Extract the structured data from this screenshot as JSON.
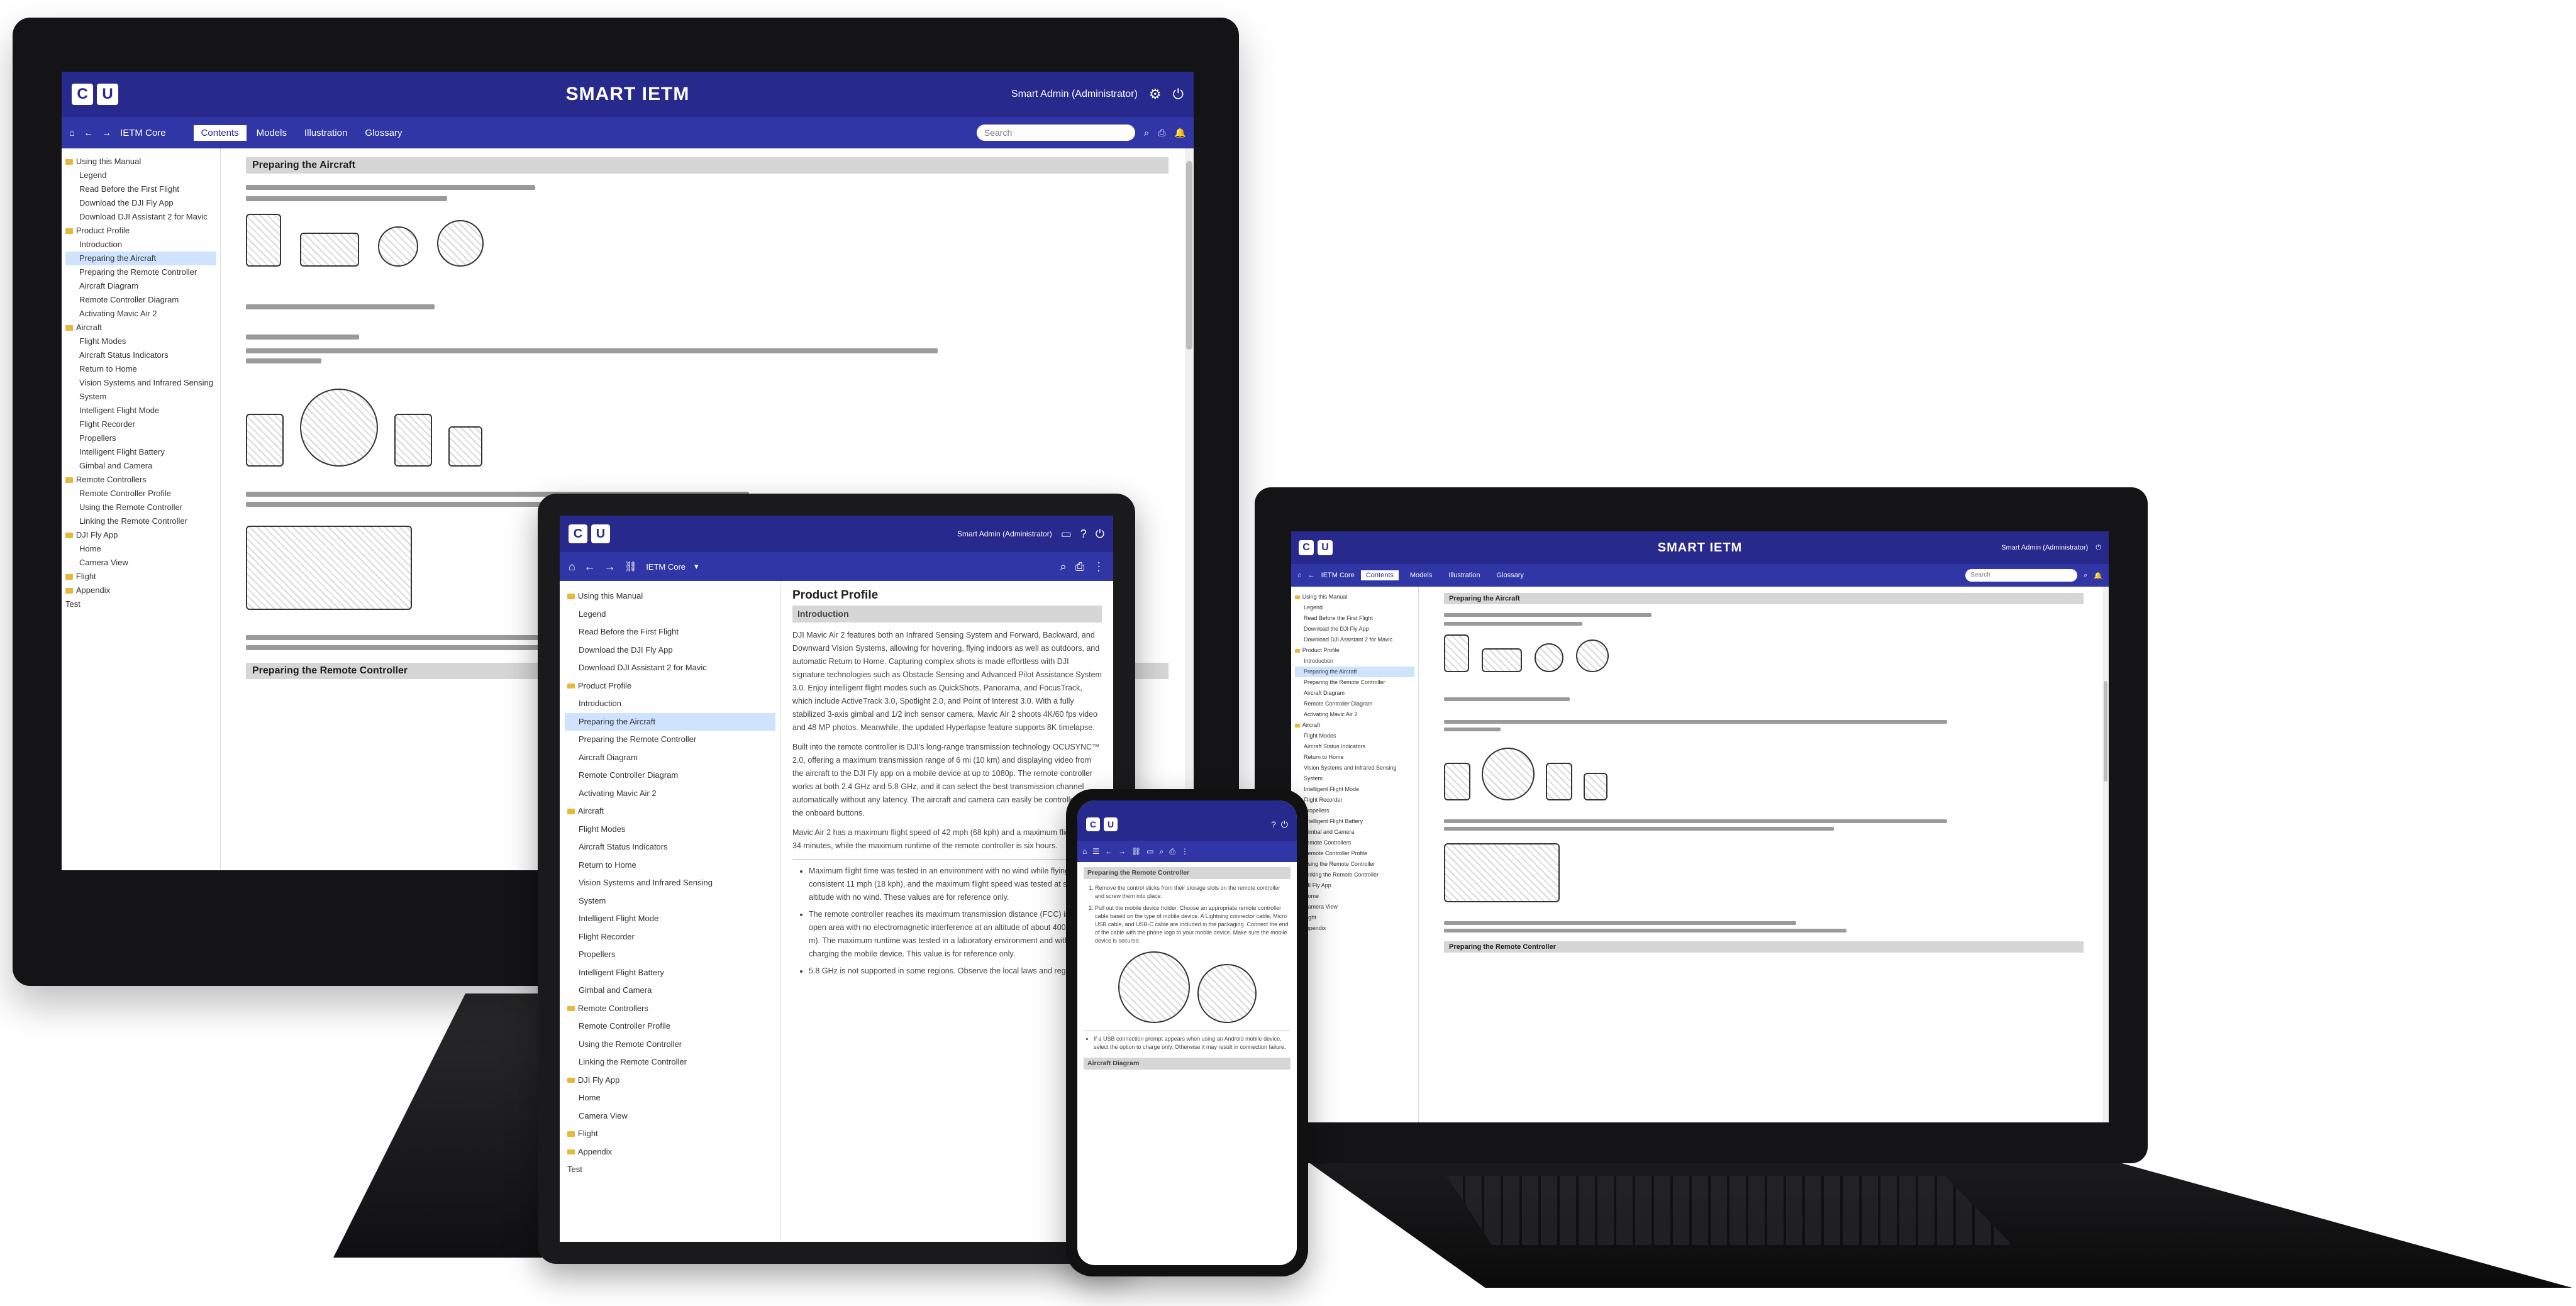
{
  "app": {
    "brand": "SMART IETM",
    "logo": [
      "C",
      "U"
    ],
    "user": "Smart Admin (Administrator)",
    "search_placeholder": "Search",
    "nav_tabs": [
      "Contents",
      "Models",
      "Illustration",
      "Glossary"
    ],
    "ietm_selector": "IETM Core"
  },
  "colors": {
    "topbar": "#27298c",
    "navbar": "#3136a6",
    "folder": "#e7b93a",
    "highlight": "#cfe3ff",
    "section_head": "#d6d6d6"
  },
  "tablet": {
    "sidebar": [
      {
        "label": "Using this Manual",
        "level": 0,
        "folder": true
      },
      {
        "label": "Legend",
        "level": 1
      },
      {
        "label": "Read Before the First Flight",
        "level": 1
      },
      {
        "label": "Download the DJI Fly App",
        "level": 1
      },
      {
        "label": "Download DJI Assistant 2 for Mavic",
        "level": 1
      },
      {
        "label": "Product Profile",
        "level": 0,
        "folder": true
      },
      {
        "label": "Introduction",
        "level": 1
      },
      {
        "label": "Preparing the Aircraft",
        "level": 1,
        "selected": true
      },
      {
        "label": "Preparing the Remote Controller",
        "level": 1
      },
      {
        "label": "Aircraft Diagram",
        "level": 1
      },
      {
        "label": "Remote Controller Diagram",
        "level": 1
      },
      {
        "label": "Activating Mavic Air 2",
        "level": 1
      },
      {
        "label": "Aircraft",
        "level": 0,
        "folder": true
      },
      {
        "label": "Flight Modes",
        "level": 1
      },
      {
        "label": "Aircraft Status Indicators",
        "level": 1
      },
      {
        "label": "Return to Home",
        "level": 1
      },
      {
        "label": "Vision Systems and Infrared Sensing",
        "level": 1
      },
      {
        "label": "System",
        "level": 1
      },
      {
        "label": "Intelligent Flight Mode",
        "level": 1
      },
      {
        "label": "Flight Recorder",
        "level": 1
      },
      {
        "label": "Propellers",
        "level": 1
      },
      {
        "label": "Intelligent Flight Battery",
        "level": 1
      },
      {
        "label": "Gimbal and Camera",
        "level": 1
      },
      {
        "label": "Remote Controllers",
        "level": 0,
        "folder": true
      },
      {
        "label": "Remote Controller Profile",
        "level": 1
      },
      {
        "label": "Using the Remote Controller",
        "level": 1
      },
      {
        "label": "Linking the Remote Controller",
        "level": 1
      },
      {
        "label": "DJI Fly App",
        "level": 0,
        "folder": true
      },
      {
        "label": "Home",
        "level": 1
      },
      {
        "label": "Camera View",
        "level": 1
      },
      {
        "label": "Flight",
        "level": 0,
        "folder": true
      },
      {
        "label": "Appendix",
        "level": 0,
        "folder": true
      },
      {
        "label": "Test",
        "level": 0
      }
    ],
    "doc_title": "Product Profile",
    "section": "Introduction",
    "paragraphs": [
      "DJI Mavic Air 2 features both an Infrared Sensing System and Forward, Backward, and Downward Vision Systems, allowing for hovering, flying indoors as well as outdoors, and automatic Return to Home. Capturing complex shots is made effortless with DJI signature technologies such as Obstacle Sensing and Advanced Pilot Assistance System 3.0. Enjoy intelligent flight modes such as QuickShots, Panorama, and FocusTrack, which include ActiveTrack 3.0, Spotlight 2.0, and Point of Interest 3.0. With a fully stabilized 3-axis gimbal and 1/2 inch sensor camera, Mavic Air 2 shoots 4K/60 fps video and 48 MP photos. Meanwhile, the updated Hyperlapse feature supports 8K timelapse.",
      "Built into the remote controller is DJI's long-range transmission technology OCUSYNC™ 2.0, offering a maximum transmission range of 6 mi (10 km) and displaying video from the aircraft to the DJI Fly app on a mobile device at up to 1080p. The remote controller works at both 2.4 GHz and 5.8 GHz, and it can select the best transmission channel automatically without any latency. The aircraft and camera can easily be controlled using the onboard buttons.",
      "Mavic Air 2 has a maximum flight speed of 42 mph (68 kph) and a maximum flight time of 34 minutes, while the maximum runtime of the remote controller is six hours."
    ],
    "bullets": [
      "Maximum flight time was tested in an environment with no wind while flying at a consistent 11 mph (18 kph), and the maximum flight speed was tested at sea level altitude with no wind. These values are for reference only.",
      "The remote controller reaches its maximum transmission distance (FCC) in a wide open area with no electromagnetic interference at an altitude of about 400 ft (120 m). The maximum runtime was tested in a laboratory environment and without charging the mobile device. This value is for reference only.",
      "5.8 GHz is not supported in some regions. Observe the local laws and regulations."
    ]
  },
  "phone": {
    "title": "Preparing the Remote Controller",
    "steps": [
      "Remove the control sticks from their storage slots on the remote controller and screw them into place.",
      "Pull out the mobile device holder. Choose an appropriate remote controller cable based on the type of mobile device. A Lightning connector cable, Micro USB cable, and USB-C cable are included in the packaging. Connect the end of the cable with the phone logo to your mobile device. Make sure the mobile device is secured."
    ],
    "note": "If a USB connection prompt appears when using an Android mobile device, select the option to charge only. Otherwise it may result in connection failure.",
    "next_section": "Aircraft Diagram"
  },
  "monitor": {
    "section": "Preparing the Aircraft",
    "sidebar": [
      "Using this Manual",
      "Legend",
      "Read Before the First Flight",
      "Download the DJI Fly App",
      "Download DJI Assistant 2 for Mavic",
      "Product Profile",
      "Introduction",
      "Preparing the Aircraft",
      "Preparing the Remote Controller",
      "Aircraft Diagram",
      "Remote Controller Diagram",
      "Activating Mavic Air 2",
      "Aircraft",
      "Flight Modes",
      "Aircraft Status Indicators",
      "Return to Home",
      "Vision Systems and Infrared Sensing",
      "System",
      "Intelligent Flight Mode",
      "Flight Recorder",
      "Propellers",
      "Intelligent Flight Battery",
      "Gimbal and Camera",
      "Remote Controllers",
      "Remote Controller Profile",
      "Using the Remote Controller",
      "Linking the Remote Controller",
      "DJI Fly App",
      "Home",
      "Camera View",
      "Flight",
      "Appendix",
      "Test"
    ],
    "bottom_section": "Preparing the Remote Controller"
  },
  "laptop": {
    "section": "Preparing the Aircraft",
    "bottom_section": "Preparing the Remote Controller"
  }
}
